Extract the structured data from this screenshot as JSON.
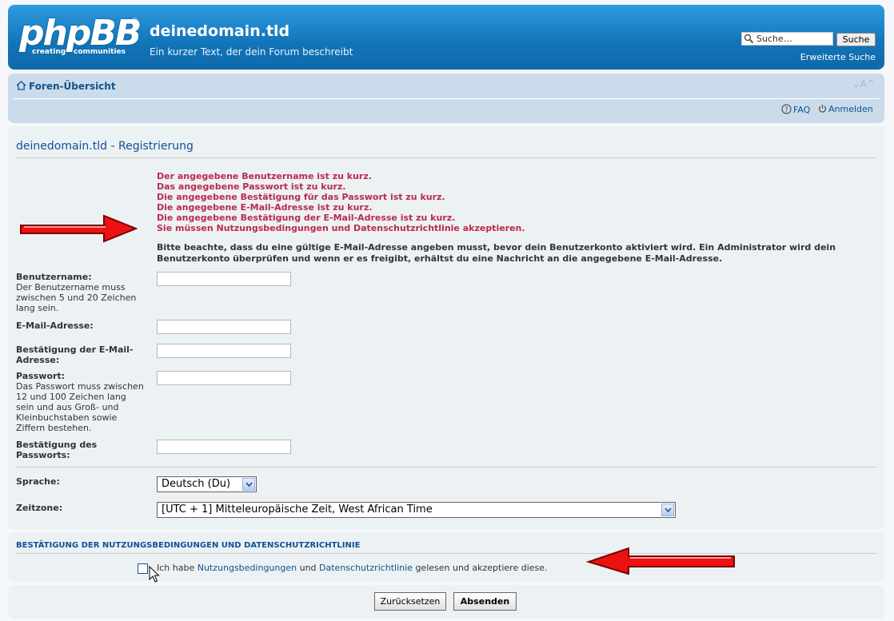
{
  "header": {
    "logo_text": "phpBB",
    "logo_tag_left": "creating",
    "logo_tag_right": "communities",
    "site_title": "deinedomain.tld",
    "site_description": "Ein kurzer Text, der dein Forum beschreibt",
    "search_placeholder": "Suche…",
    "search_button": "Suche",
    "advanced_search": "Erweiterte Suche"
  },
  "nav": {
    "home": "Foren-Übersicht",
    "font_size": "⌄A^",
    "faq": "FAQ",
    "login": "Anmelden"
  },
  "registration": {
    "title": "deinedomain.tld - Registrierung",
    "errors": [
      "Der angegebene Benutzername ist zu kurz.",
      "Das angegebene Passwort ist zu kurz.",
      "Die angegebene Bestätigung für das Passwort ist zu kurz.",
      "Die angegebene E-Mail-Adresse ist zu kurz.",
      "Die angegebene Bestätigung der E-Mail-Adresse ist zu kurz.",
      "Sie müssen Nutzungsbedingungen und Datenschutzrichtlinie akzeptieren."
    ],
    "notice": "Bitte beachte, dass du eine gültige E-Mail-Adresse angeben musst, bevor dein Benutzerkonto aktiviert wird. Ein Administrator wird dein Benutzerkonto überprüfen und wenn er es freigibt, erhältst du eine Nachricht an die angegebene E-Mail-Adresse.",
    "fields": {
      "username_label": "Benutzername:",
      "username_hint": "Der Benutzername muss zwischen 5 und 20 Zeichen lang sein.",
      "email_label": "E-Mail-Adresse:",
      "email_confirm_label": "Bestätigung der E-Mail-Adresse:",
      "password_label": "Passwort:",
      "password_hint": "Das Passwort muss zwischen 12 und 100 Zeichen lang sein und aus Groß- und Kleinbuchstaben sowie Ziffern bestehen.",
      "password_confirm_label": "Bestätigung des Passworts:",
      "language_label": "Sprache:",
      "language_value": "Deutsch (Du)",
      "timezone_label": "Zeitzone:",
      "timezone_value": "[UTC + 1] Mitteleuropäische Zeit, West African Time"
    }
  },
  "terms": {
    "title": "BESTÄTIGUNG DER NUTZUNGSBEDINGUNGEN UND DATENSCHUTZRICHTLINIE",
    "text_1": "Ich habe",
    "link_terms": "Nutzungsbedingungen",
    "text_2": "und",
    "link_privacy": "Datenschutzrichtlinie",
    "text_3": "gelesen und akzeptiere diese.",
    "checked": false
  },
  "buttons": {
    "reset": "Zurücksetzen",
    "submit": "Absenden"
  },
  "colors": {
    "header_blue": "#1274b8",
    "nav_bg": "#cadceb",
    "panel_bg": "#ecf1f3",
    "error_red": "#bc2a4d",
    "link_blue": "#105289",
    "arrow_red": "#e00000"
  }
}
